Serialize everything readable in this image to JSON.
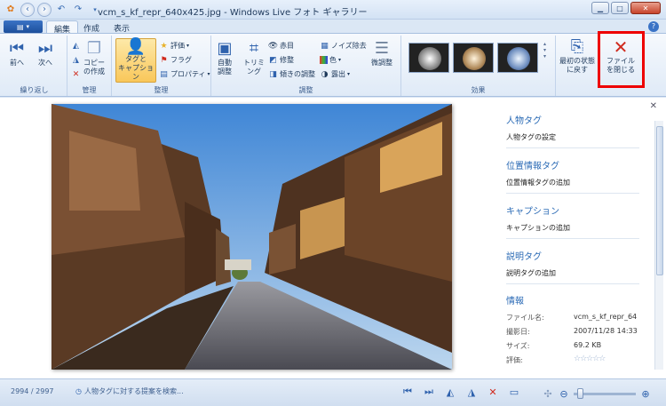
{
  "window": {
    "title": "vcm_s_kf_repr_640x425.jpg - Windows Live フォト ギャラリー"
  },
  "tabs": [
    "編集",
    "作成",
    "表示"
  ],
  "ribbon": {
    "groups": {
      "navigate": "繰り返し",
      "manage": "管理",
      "organize": "整理",
      "adjust": "調整",
      "effects": "効果"
    },
    "buttons": {
      "prev": "前へ",
      "next": "次へ",
      "copy_line1": "コピー",
      "copy_line2": "の作成",
      "tag_line1": "タグと",
      "tag_line2": "キャプション",
      "rating": "評価",
      "flag": "フラグ",
      "properties": "プロパティ",
      "auto_line1": "自動",
      "auto_line2": "調整",
      "crop_line1": "トリミ",
      "crop_line2": "ング",
      "redeye": "赤目",
      "retouch": "修整",
      "straighten": "傾きの調整",
      "noise": "ノイズ除去",
      "color": "色",
      "exposure": "露出",
      "finetune": "微調整",
      "revert_line1": "最初の状態",
      "revert_line2": "に戻す",
      "close_line1": "ファイル",
      "close_line2": "を閉じる"
    }
  },
  "sidepanel": {
    "people_title": "人物タグ",
    "people_link": "人物タグの設定",
    "geo_title": "位置情報タグ",
    "geo_link": "位置情報タグの追加",
    "caption_title": "キャプション",
    "caption_link": "キャプションの追加",
    "desc_title": "説明タグ",
    "desc_link": "説明タグの追加",
    "info_title": "情報",
    "info": [
      {
        "label": "ファイル名:",
        "value": "vcm_s_kf_repr_64"
      },
      {
        "label": "撮影日:",
        "value": "2007/11/28  14:33"
      },
      {
        "label": "サイズ:",
        "value": "69.2 KB"
      },
      {
        "label": "評価:",
        "value": ""
      }
    ],
    "rating_stars": "☆☆☆☆☆"
  },
  "status": {
    "count": "2994 / 2997",
    "hint": "人物タグに対する提案を検索..."
  },
  "colors": {
    "accent": "#2a6ab5",
    "highlight": "#ee0000"
  }
}
